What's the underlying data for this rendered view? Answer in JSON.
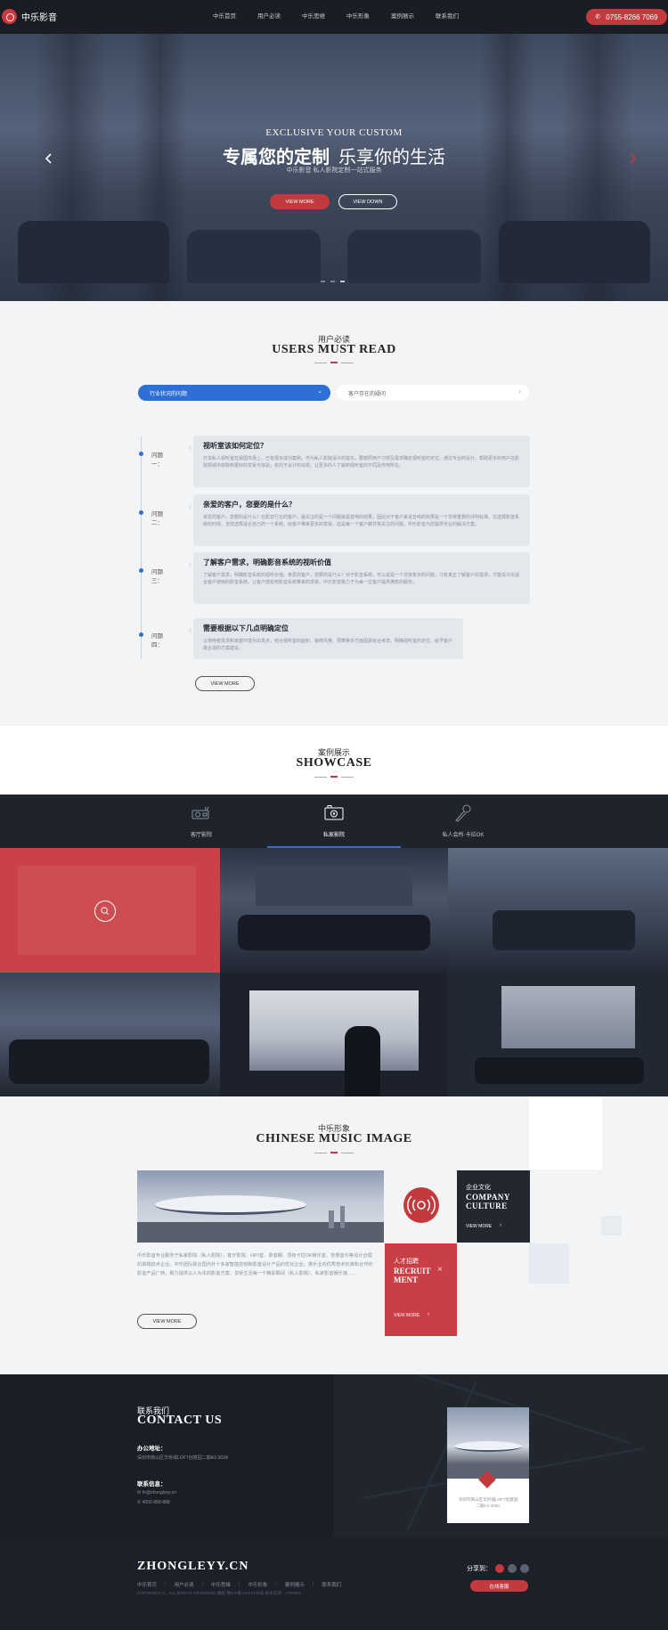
{
  "header": {
    "brand": "中乐影音",
    "nav": [
      "中乐首页",
      "用户必读",
      "中乐思维",
      "中乐形象",
      "案例展示",
      "联系我们"
    ],
    "phone": "0755-8266 7069"
  },
  "hero": {
    "subtitle": "EXCLUSIVE YOUR CUSTOM",
    "title_bold": "专属您的定制",
    "title_light": "乐享你的生活",
    "desc": "中乐影音 私人影院定制一站式服务",
    "btn_more": "VIEW MORE",
    "btn_down": "VIEW DOWN",
    "slide_count": 3,
    "active_slide": 2
  },
  "users": {
    "sub": "用户必读",
    "title": "USERS MUST READ",
    "select_label": "行业状况的问题",
    "link_label": "客户存在的疑问",
    "items": [
      {
        "label": "问题一：",
        "title": "视听室该如何定位？",
        "body": "打造私人视听室在我国市场上，已有很多成功案例。作为私人影院设计的首先，要按照用户习惯及需求确定视听室的定位，通过专业的设计，帮助更多的用户在影院领域中获取到更好的享受与体验，依托于设计的出现，让更多的人了解到视听室的不同及作用所在。"
      },
      {
        "label": "问题二：",
        "title": "亲爱的客户，您要的是什么？",
        "body": "亲爱的客户，您要的是什么？在影音行业的客户，最关注的是一个问题就是音响的效果，因此对于客户来说音响的效果是一个非常重要的评判标准。在选择影音系统的时候，怎样选择适合自己的一个系统，给客户带来更多的享受，这是每一个客户都非常关注的问题，中乐影音为您提供专业的解决方案。"
      },
      {
        "label": "问题三：",
        "title": "了解客户需求，明确影音系统的视听价值",
        "body": "了解客户需求，明确影音系统的视听价值。亲爱的客户，您要的是什么？对于影音系统，可以说是一个非常复杂的问题，只有真正了解客户的需求，才能设计出适合客户使用的影音系统，让客户感受到影音系统带来的享受，中乐影音致力于为每一位客户提供满意的服务。"
      },
      {
        "label": "问题四：",
        "title": "需要根据以下几点明确定位",
        "body": "以使用者需求和家庭环境为出发点，结合视听室的面积、装修风格、预算等多方面因素综合考虑，明确视听室的定位，给予客户最合适的方案建议。"
      }
    ],
    "btn_more": "VIEW MORE"
  },
  "showcase": {
    "sub": "案例展示",
    "title": "SHOWCASE",
    "tabs": [
      {
        "label": "客厅影院",
        "icon": "projector-icon"
      },
      {
        "label": "私家影院",
        "icon": "theater-icon"
      },
      {
        "label": "私人会所·卡拉OK",
        "icon": "microphone-icon"
      }
    ],
    "active_tab": 1
  },
  "music": {
    "sub": "中乐形象",
    "title": "CHINESE MUSIC IMAGE",
    "text": "中乐影音专业服务于私家影院（私人影院），客厅影院、HIFI室、录音棚、顶级卡拉OK娱乐室、背景音乐等设计合理的高端技术企业。中乐团队联合国内外十多家智能控制和影音设计产品的优化企业，携手业内优秀技术标准和合作的影音产品厂商，致力提供以人为本的影音方案，享受生活每一个精彩瞬间（私人影院）、私家影音娱乐馆……",
    "btn_more": "VIEW MORE",
    "culture_cn": "企业文化",
    "culture_en1": "COMPANY",
    "culture_en2": "CULTURE",
    "culture_more": "VIEW MORE",
    "recruit_cn": "人才招聘",
    "recruit_en1": "RECRUIT",
    "recruit_en2": "MENT",
    "recruit_more": "VIEW MORE"
  },
  "contact": {
    "cn": "联系我们",
    "en": "CONTACT US",
    "address_label": "办公地址：",
    "address": "深圳市南山区华侨城LOFT创意园二期A2-303A",
    "info_label": "联系信息：",
    "email": "hr@zhongleyy.cn",
    "phone": "4000-888-888",
    "map_address_line1": "深圳市南山区华侨城LOFT创意园",
    "map_address_line2": "二期A2-303A"
  },
  "footer": {
    "brand": "ZHONGLEYY.CN",
    "nav": [
      "中乐首页",
      "用户必读",
      "中乐思维",
      "中乐形象",
      "案例展示",
      "联系我们"
    ],
    "copyright": "COPYRIGHT © . ALL RIGHTS RESERVED 版权  粤ICP备12071704号    技术支持：CTWDN",
    "share_label": "分享到：",
    "consult": "在线客服"
  },
  "colors": {
    "accent_red": "#c4393d",
    "accent_blue": "#2e6fd6",
    "dark": "#1a1d24"
  }
}
